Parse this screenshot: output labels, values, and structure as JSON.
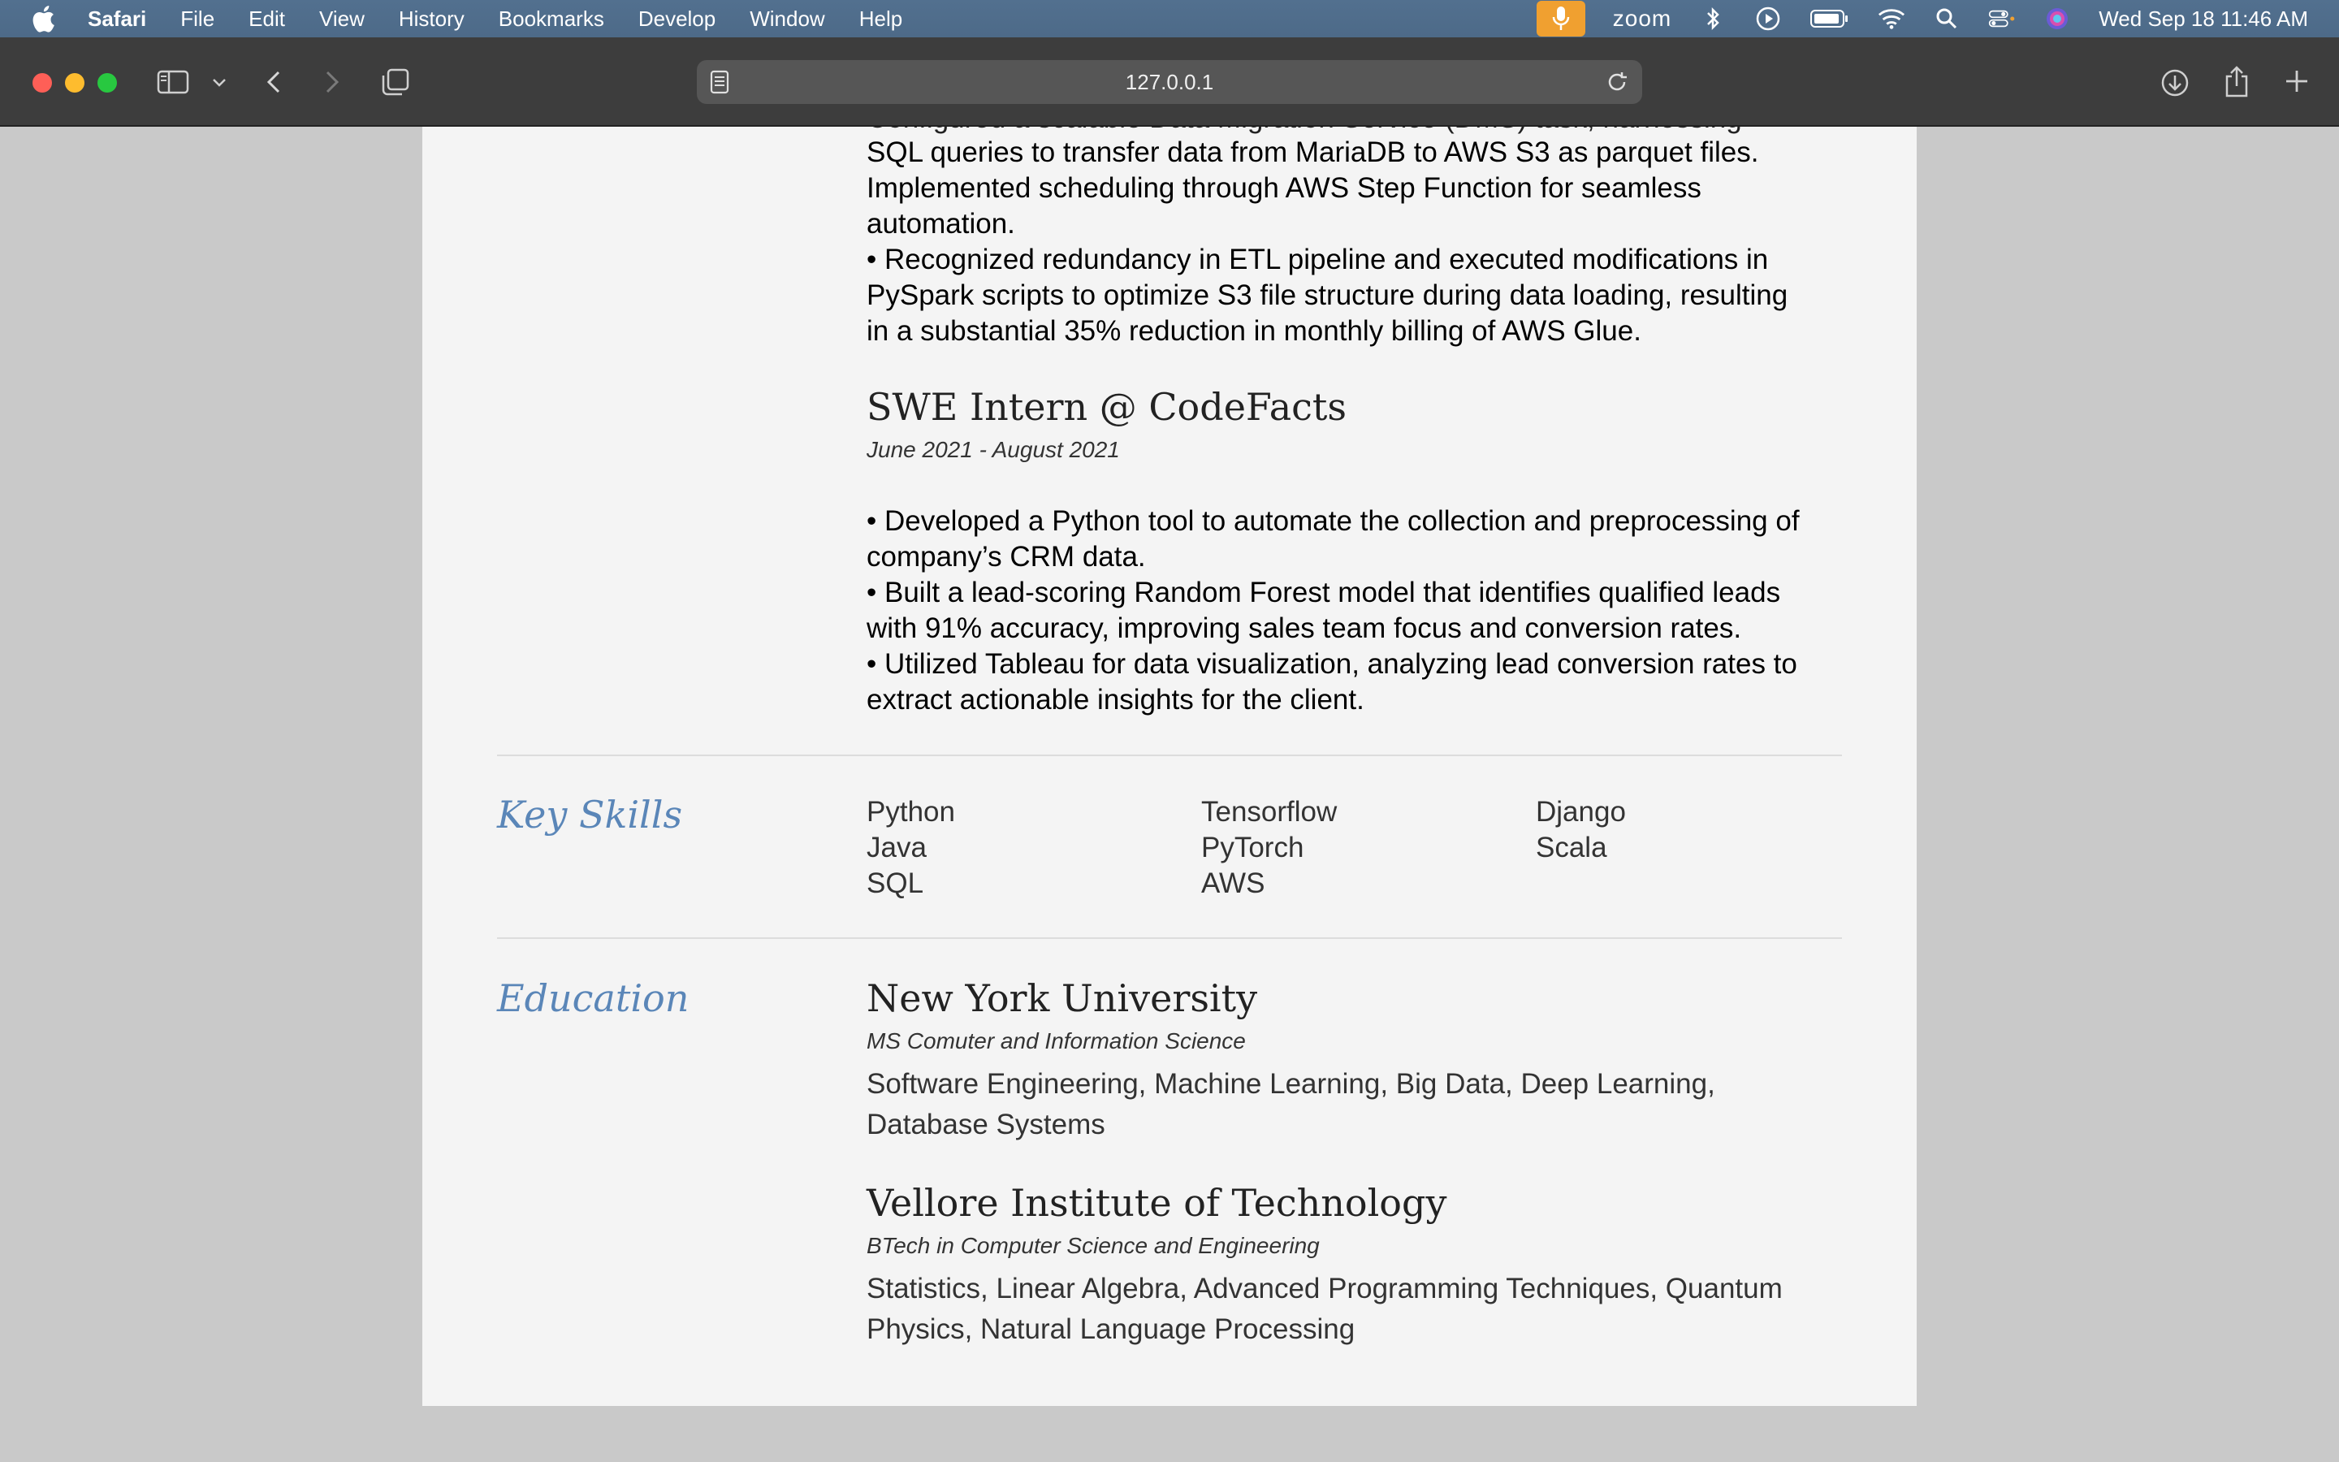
{
  "menubar": {
    "app": "Safari",
    "items": [
      "File",
      "Edit",
      "View",
      "History",
      "Bookmarks",
      "Develop",
      "Window",
      "Help"
    ],
    "zoom": "zoom",
    "datetime": "Wed Sep 18  11:46 AM"
  },
  "toolbar": {
    "url": "127.0.0.1"
  },
  "experience": {
    "clipped_line": "Configured a scalable Data Migration Service (DMS) task, harnessing",
    "job1_bullet1_lines": [
      "SQL queries to transfer data from MariaDB to AWS S3 as parquet files.",
      "Implemented scheduling through AWS Step Function for seamless",
      "automation."
    ],
    "job1_bullet2_lines": [
      "•  Recognized redundancy in ETL pipeline and executed modifications in",
      "PySpark scripts to optimize S3 file structure during data loading, resulting",
      "in a substantial 35% reduction in monthly billing of AWS Glue."
    ],
    "job2": {
      "title": "SWE Intern @ CodeFacts",
      "date": "June 2021 - August 2021",
      "bullet_lines": [
        "•  Developed a Python tool to automate the collection and preprocessing of",
        "company’s CRM data.",
        "•  Built a lead-scoring Random Forest model that identifies qualified leads",
        "with 91% accuracy, improving sales team focus and conversion rates.",
        "•  Utilized Tableau for data visualization, analyzing lead conversion rates to",
        "extract actionable insights for the client."
      ]
    }
  },
  "skills": {
    "label": "Key Skills",
    "items": [
      "Python",
      "Tensorflow",
      "Django",
      "Java",
      "PyTorch",
      "Scala",
      "SQL",
      "AWS",
      ""
    ]
  },
  "education": {
    "label": "Education",
    "schools": [
      {
        "name": "New York University",
        "degree": "MS Comuter and Information Science",
        "courses_lines": [
          "Software Engineering, Machine Learning, Big Data, Deep Learning,",
          "Database Systems"
        ]
      },
      {
        "name": "Vellore Institute of Technology",
        "degree": "BTech in Computer Science and Engineering",
        "courses_lines": [
          "Statistics, Linear Algebra, Advanced Programming Techniques, Quantum",
          "Physics, Natural Language Processing"
        ]
      }
    ]
  }
}
